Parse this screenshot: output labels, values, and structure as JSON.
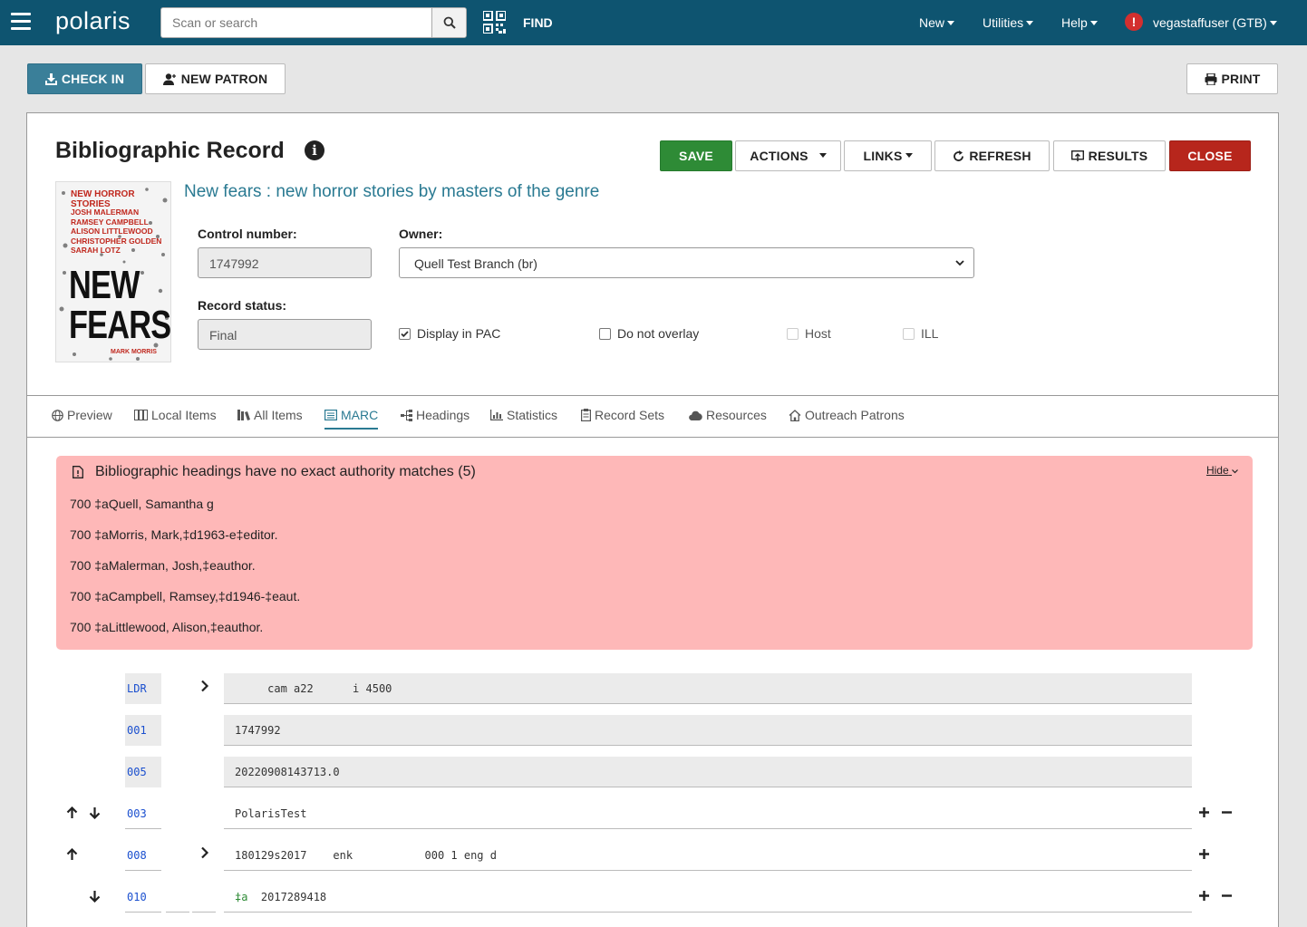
{
  "topbar": {
    "logo": "polaris",
    "search_placeholder": "Scan or search",
    "find_label": "FIND",
    "menu_new": "New",
    "menu_utilities": "Utilities",
    "menu_help": "Help",
    "alert_mark": "!",
    "user": "vegastaffuser (GTB)"
  },
  "actions": {
    "check_in": "CHECK IN",
    "new_patron": "NEW PATRON",
    "print": "PRINT"
  },
  "record": {
    "heading": "Bibliographic Record",
    "info_mark": "i",
    "save": "SAVE",
    "actions": "ACTIONS",
    "links": "LINKS",
    "refresh": "REFRESH",
    "results": "RESULTS",
    "close": "CLOSE",
    "title": "New fears : new horror stories by masters of the genre",
    "control_number_label": "Control number:",
    "control_number": "1747992",
    "owner_label": "Owner:",
    "owner": "Quell Test Branch (br)",
    "record_status_label": "Record status:",
    "record_status": "Final",
    "checkboxes": {
      "display_in_pac": "Display in PAC",
      "display_in_pac_checked": true,
      "do_not_overlay": "Do not overlay",
      "do_not_overlay_checked": false,
      "host": "Host",
      "ill": "ILL"
    }
  },
  "cover": {
    "head": "NEW HORROR STORIES",
    "names": [
      "JOSH MALERMAN",
      "RAMSEY CAMPBELL",
      "ALISON LITTLEWOOD",
      "CHRISTOPHER GOLDEN",
      "SARAH LOTZ"
    ],
    "big1": "NEW",
    "big2": "FEARS",
    "editor": "MARK MORRIS"
  },
  "tabs": [
    "Preview",
    "Local Items",
    "All Items",
    "MARC",
    "Headings",
    "Statistics",
    "Record Sets",
    "Resources",
    "Outreach Patrons"
  ],
  "active_tab": "MARC",
  "alert": {
    "title": "Bibliographic headings have no exact authority matches (5)",
    "hide": "Hide",
    "lines": [
      "700 ‡aQuell, Samantha g",
      "700 ‡aMorris, Mark,‡d1963-e‡editor.",
      "700 ‡aMalerman, Josh,‡eauthor.",
      "700 ‡aCampbell, Ramsey,‡d1946-‡eaut.",
      "700 ‡aLittlewood, Alison,‡eauthor."
    ]
  },
  "marc": {
    "ldr_tag": "LDR",
    "ldr_value": "     cam a22      i 4500",
    "f001_tag": "001",
    "f001_value": "1747992",
    "f005_tag": "005",
    "f005_value": "20220908143713.0",
    "f003_tag": "003",
    "f003_value": "PolarisTest",
    "f008_tag": "008",
    "f008_value": "180129s2017    enk           000 1 eng d",
    "f010_tag": "010",
    "f010_sub": "‡a",
    "f010_value": "2017289418"
  },
  "colors": {
    "topbar": "#0e5470",
    "save": "#2e8b36",
    "close": "#b7261c",
    "accent": "#2a7a92",
    "alert_bg": "#feb8b8"
  }
}
